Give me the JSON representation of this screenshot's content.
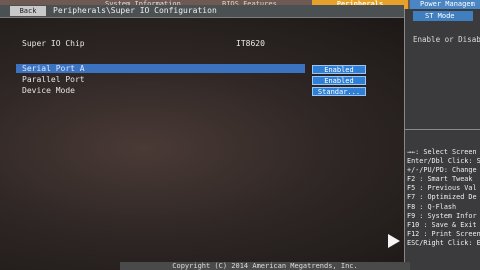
{
  "tabs": {
    "system_info": "System Information",
    "bios_features": "BIOS Features",
    "peripherals": "Peripherals",
    "power": "Power Managem"
  },
  "breadcrumb": {
    "back_label": "Back",
    "path": "Peripherals\\Super IO Configuration"
  },
  "right_panel": {
    "mode_label": "ST Mode",
    "help_text": "Enable or Disab",
    "keys": [
      "→←: Select Screen",
      "Enter/Dbl Click: S",
      "+/-/PU/PD: Change",
      "F2  : Smart Tweak",
      "F5  : Previous Val",
      "F7  : Optimized De",
      "F8  : Q-Flash",
      "F9  : System Infor",
      "F10 : Save & Exit",
      "F12 : Print Screen",
      "ESC/Right Click: Ex"
    ]
  },
  "main": {
    "chip_label": "Super IO Chip",
    "chip_value": "IT8620",
    "items": [
      {
        "label": "Serial Port A",
        "value": "Enabled"
      },
      {
        "label": "Parallel Port",
        "value": "Enabled"
      },
      {
        "label": "Device Mode",
        "value": "Standar..."
      }
    ]
  },
  "footer": {
    "copyright": "Copyright (C) 2014 American Megatrends, Inc."
  }
}
